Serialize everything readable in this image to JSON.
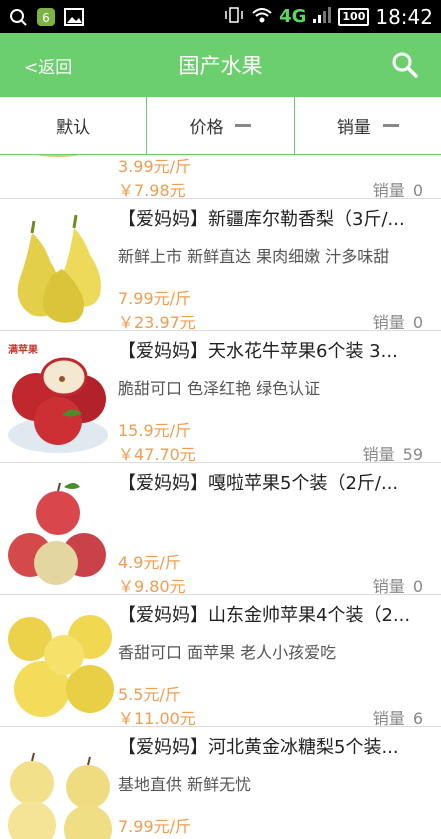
{
  "status": {
    "network": "4G",
    "battery": "100",
    "time": "18:42"
  },
  "nav": {
    "back_label": "<返回",
    "title": "国产水果"
  },
  "sort": {
    "default": "默认",
    "price": "价格",
    "sales": "销量"
  },
  "colors": {
    "brand": "#6ccf6e",
    "price": "#f39c4e"
  },
  "partial": {
    "unit": "3.99元/斤",
    "price": "￥7.98元",
    "sales_label": "销量",
    "sales": "0"
  },
  "items": [
    {
      "title": "【爱妈妈】新疆库尔勒香梨（3斤/...",
      "desc": "新鲜上市 新鲜直达 果肉细嫩 汁多味甜",
      "unit": "7.99元/斤",
      "price": "￥23.97元",
      "sales_label": "销量",
      "sales": "0",
      "tag": "",
      "fruit": "pear-icon"
    },
    {
      "title": "【爱妈妈】天水花牛苹果6个装 3...",
      "desc": "脆甜可口 色泽红艳 绿色认证",
      "unit": "15.9元/斤",
      "price": "￥47.70元",
      "sales_label": "销量",
      "sales": "59",
      "tag": "满苹果",
      "fruit": "apple-icon"
    },
    {
      "title": "【爱妈妈】嘎啦苹果5个装（2斤/...",
      "desc": "",
      "unit": "4.9元/斤",
      "price": "￥9.80元",
      "sales_label": "销量",
      "sales": "0",
      "tag": "",
      "fruit": "apple-icon"
    },
    {
      "title": "【爱妈妈】山东金帅苹果4个装（2...",
      "desc": "香甜可口 面苹果 老人小孩爱吃",
      "unit": "5.5元/斤",
      "price": "￥11.00元",
      "sales_label": "销量",
      "sales": "6",
      "tag": "",
      "fruit": "yellow-apple-icon"
    },
    {
      "title": "【爱妈妈】河北黄金冰糖梨5个装...",
      "desc": "基地直供  新鲜无忧",
      "unit": "7.99元/斤",
      "price": "",
      "sales_label": "",
      "sales": "",
      "tag": "",
      "fruit": "pear-icon"
    }
  ]
}
